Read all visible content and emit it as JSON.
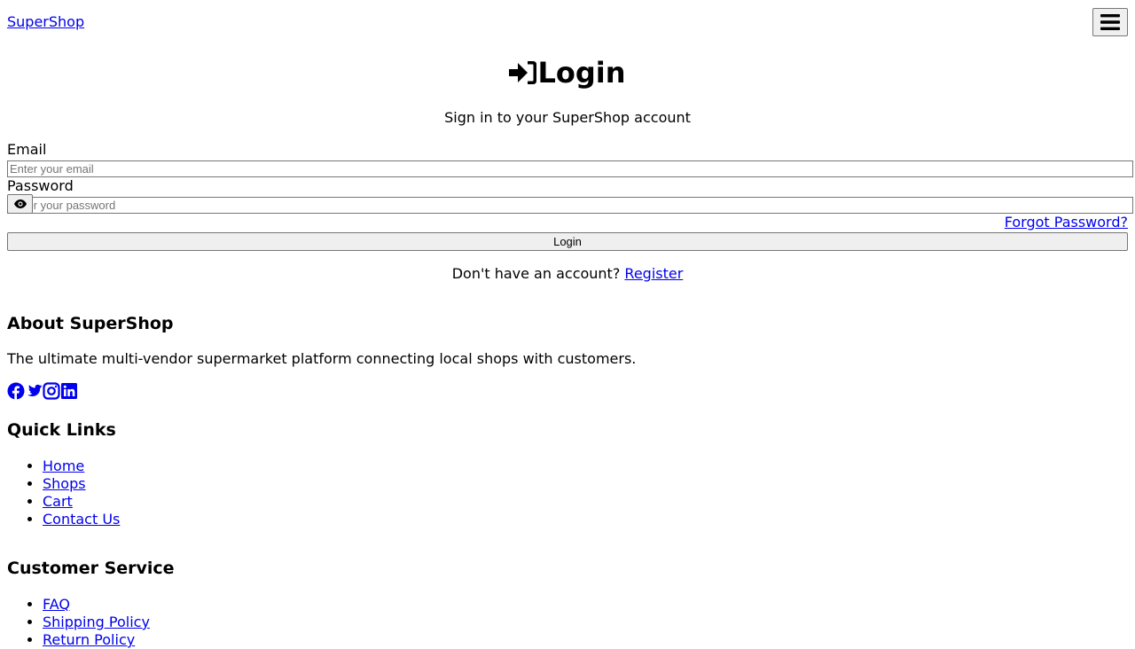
{
  "header": {
    "brand": "SuperShop",
    "menu_icon": "hamburger-icon"
  },
  "login": {
    "title": "Login",
    "title_icon": "sign-in-icon",
    "subtitle": "Sign in to your SuperShop account",
    "email_label": "Email",
    "email_placeholder": "Enter your email",
    "password_label": "Password",
    "password_placeholder": "Enter your password",
    "toggle_icon": "eye-icon",
    "forgot_link": "Forgot Password?",
    "submit_label": "Login",
    "register_prompt": "Don't have an account?",
    "register_link": "Register"
  },
  "footer": {
    "about": {
      "heading": "About SuperShop",
      "text": "The ultimate multi-vendor supermarket platform connecting local shops with customers.",
      "social_icons": [
        "facebook-icon",
        "twitter-icon",
        "instagram-icon",
        "linkedin-icon"
      ]
    },
    "quick_links": {
      "heading": "Quick Links",
      "items": [
        "Home",
        "Shops",
        "Cart",
        "Contact Us"
      ]
    },
    "customer_service": {
      "heading": "Customer Service",
      "items": [
        "FAQ",
        "Shipping Policy",
        "Return Policy"
      ]
    }
  },
  "colors": {
    "link": "#0000ee",
    "button_bg": "#efefef",
    "border": "#767676"
  }
}
